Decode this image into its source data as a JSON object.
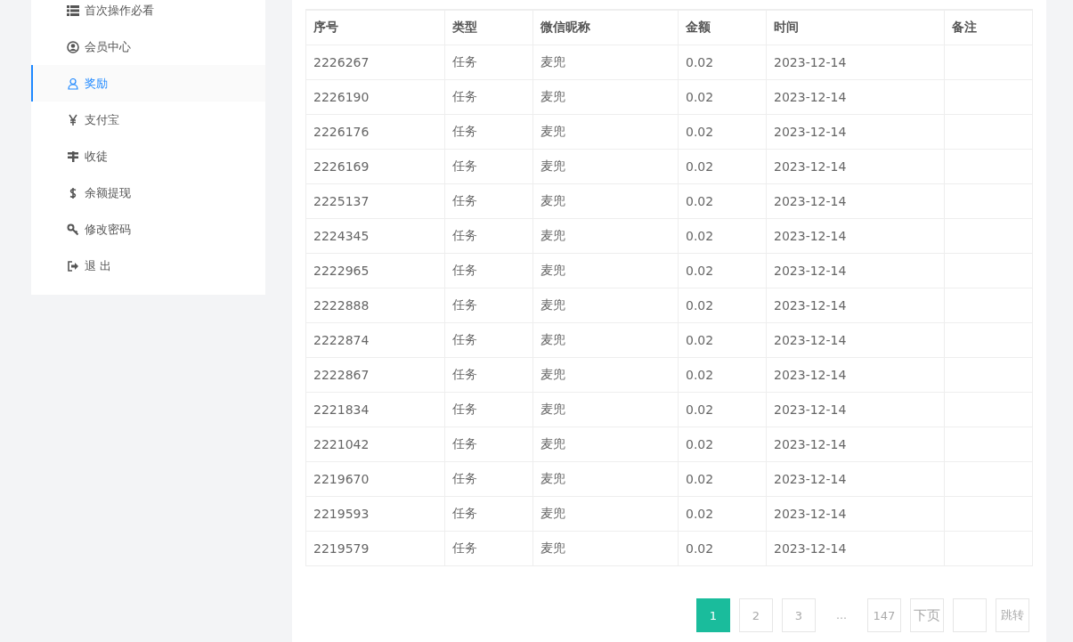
{
  "sidebar": {
    "items": [
      {
        "label": "首次操作必看",
        "kind": "list",
        "selected": false
      },
      {
        "label": "会员中心",
        "kind": "member",
        "selected": false
      },
      {
        "label": "奖励",
        "kind": "reward",
        "selected": true
      },
      {
        "label": "支付宝",
        "kind": "alipay",
        "selected": false
      },
      {
        "label": "收徒",
        "kind": "recruit",
        "selected": false
      },
      {
        "label": "余额提现",
        "kind": "withdraw",
        "selected": false
      },
      {
        "label": "修改密码",
        "kind": "password",
        "selected": false
      },
      {
        "label": "退 出",
        "kind": "logout",
        "selected": false
      }
    ]
  },
  "table": {
    "columns": [
      "序号",
      "类型",
      "微信昵称",
      "金额",
      "时间",
      "备注"
    ],
    "rows": [
      [
        "2226267",
        "任务",
        "麦兜",
        "0.02",
        "2023-12-14"
      ],
      [
        "2226190",
        "任务",
        "麦兜",
        "0.02",
        "2023-12-14"
      ],
      [
        "2226176",
        "任务",
        "麦兜",
        "0.02",
        "2023-12-14"
      ],
      [
        "2226169",
        "任务",
        "麦兜",
        "0.02",
        "2023-12-14"
      ],
      [
        "2225137",
        "任务",
        "麦兜",
        "0.02",
        "2023-12-14"
      ],
      [
        "2224345",
        "任务",
        "麦兜",
        "0.02",
        "2023-12-14"
      ],
      [
        "2222965",
        "任务",
        "麦兜",
        "0.02",
        "2023-12-14"
      ],
      [
        "2222888",
        "任务",
        "麦兜",
        "0.02",
        "2023-12-14"
      ],
      [
        "2222874",
        "任务",
        "麦兜",
        "0.02",
        "2023-12-14"
      ],
      [
        "2222867",
        "任务",
        "麦兜",
        "0.02",
        "2023-12-14"
      ],
      [
        "2221834",
        "任务",
        "麦兜",
        "0.02",
        "2023-12-14"
      ],
      [
        "2221042",
        "任务",
        "麦兜",
        "0.02",
        "2023-12-14"
      ],
      [
        "2219670",
        "任务",
        "麦兜",
        "0.02",
        "2023-12-14"
      ],
      [
        "2219593",
        "任务",
        "麦兜",
        "0.02",
        "2023-12-14"
      ],
      [
        "2219579",
        "任务",
        "麦兜",
        "0.02",
        "2023-12-14"
      ]
    ]
  },
  "pagination": {
    "items": [
      {
        "kind": "page",
        "label": "1",
        "selected": true
      },
      {
        "kind": "page",
        "label": "2",
        "selected": false
      },
      {
        "kind": "page",
        "label": "3",
        "selected": false
      },
      {
        "kind": "ellipsis",
        "label": "…"
      },
      {
        "kind": "page",
        "label": "147",
        "selected": false
      },
      {
        "kind": "next",
        "label": "下页"
      },
      {
        "kind": "input"
      },
      {
        "kind": "go",
        "label": "跳转"
      }
    ]
  }
}
